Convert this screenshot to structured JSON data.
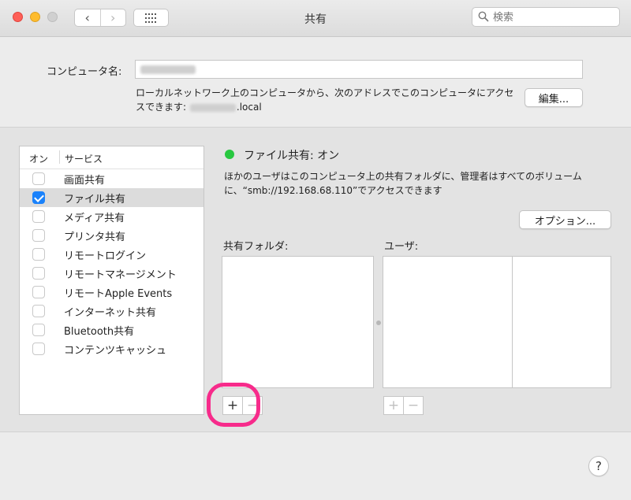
{
  "window": {
    "title": "共有"
  },
  "toolbar": {
    "back_glyph": "‹",
    "forward_glyph": "›",
    "search_placeholder": "検索"
  },
  "computer": {
    "name_label": "コンピュータ名:",
    "address_text_pre": "ローカルネットワーク上のコンピュータから、次のアドレスでこのコンピュータにアクセスできます:",
    "address_suffix": ".local",
    "edit_label": "編集..."
  },
  "services": {
    "col_on": "オン",
    "col_service": "サービス",
    "items": [
      {
        "label": "画面共有",
        "checked": false,
        "selected": false
      },
      {
        "label": "ファイル共有",
        "checked": true,
        "selected": true
      },
      {
        "label": "メディア共有",
        "checked": false,
        "selected": false
      },
      {
        "label": "プリンタ共有",
        "checked": false,
        "selected": false
      },
      {
        "label": "リモートログイン",
        "checked": false,
        "selected": false
      },
      {
        "label": "リモートマネージメント",
        "checked": false,
        "selected": false
      },
      {
        "label": "リモートApple Events",
        "checked": false,
        "selected": false
      },
      {
        "label": "インターネット共有",
        "checked": false,
        "selected": false
      },
      {
        "label": "Bluetooth共有",
        "checked": false,
        "selected": false
      },
      {
        "label": "コンテンツキャッシュ",
        "checked": false,
        "selected": false
      }
    ]
  },
  "detail": {
    "status": "ファイル共有: オン",
    "status_color": "#28c840",
    "description": "ほかのユーザはこのコンピュータ上の共有フォルダに、管理者はすべてのボリュームに、“smb://192.168.68.110”でアクセスできます",
    "options_label": "オプション...",
    "shared_folders_label": "共有フォルダ:",
    "users_label": "ユーザ:",
    "plus": "+",
    "minus": "−"
  },
  "help": {
    "label": "?"
  },
  "colors": {
    "accent": "#1a82fb",
    "highlight": "#f72b8b"
  }
}
